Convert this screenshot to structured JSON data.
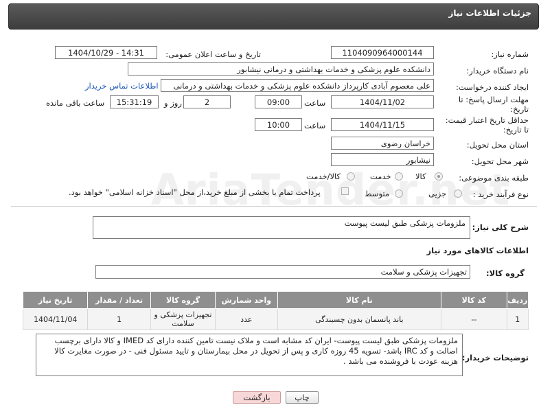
{
  "header": {
    "title": "جزئیات اطلاعات نیاز"
  },
  "fields": {
    "need_number_label": "شماره نیاز:",
    "need_number": "1104090964000144",
    "announce_label": "تاریخ و ساعت اعلان عمومی:",
    "announce_value": "1404/10/29 - 14:31",
    "buyer_org_label": "نام دستگاه خریدار:",
    "buyer_org": "دانشکده علوم پزشکی و خدمات بهداشتی و درمانی نیشابور",
    "creator_label": "ایجاد کننده درخواست:",
    "creator": "علی معصوم آبادی کارپرداز دانشکده علوم پزشکی و خدمات بهداشتی و درمانی",
    "contact_link": "اطلاعات تماس خریدار",
    "deadline_label_1": "مهلت ارسال پاسخ: تا",
    "deadline_label_2": "تاریخ:",
    "deadline_date": "1404/11/02",
    "time_word": "ساعت",
    "deadline_time": "09:00",
    "days_value": "2",
    "days_word": "روز و",
    "remaining_time": "15:31:19",
    "remaining_word": "ساعت باقی مانده",
    "validity_label_1": "حداقل تاریخ اعتبار قیمت:",
    "validity_label_2": "تا تاریخ:",
    "validity_date": "1404/11/15",
    "validity_time": "10:00",
    "province_label": "استان محل تحویل:",
    "province": "خراسان رضوی",
    "city_label": "شهر محل تحویل:",
    "city": "نیشابور",
    "category_label": "طبقه بندی موضوعی:",
    "category_options": [
      "کالا",
      "خدمت",
      "کالا/خدمت"
    ],
    "category_selected": "کالا",
    "process_label": "نوع فرآیند خرید :",
    "process_options": [
      "جزیی",
      "متوسط"
    ],
    "payment_note": "پرداخت تمام یا بخشی از مبلغ خرید،از محل \"اسناد خزانه اسلامی\" خواهد بود."
  },
  "description": {
    "label": "شرح کلی نیاز:",
    "value": "ملزومات پزشکی طبق لیست پیوست"
  },
  "goods_section": {
    "title": "اطلاعات کالاهای مورد نیاز",
    "group_label": "گروه کالا:",
    "group_value": "تجهیزات پزشکی و سلامت"
  },
  "table": {
    "headers": [
      "ردیف",
      "کد کالا",
      "نام کالا",
      "واحد شمارش",
      "گروه کالا",
      "تعداد / مقدار",
      "تاریخ نیاز"
    ],
    "rows": [
      {
        "row": "1",
        "code": "--",
        "name": "باند پانسمان بدون چسبندگی",
        "unit": "عدد",
        "group": "تجهیزات پزشکی و سلامت",
        "qty": "1",
        "date": "1404/11/04"
      }
    ]
  },
  "buyer_notes": {
    "label": "توضیحات خریدار:",
    "value": "ملزومات پزشکی طبق لیست پیوست- ایران کد مشابه است و ملاک نیست  تامین کننده دارای کد IMED  و کالا دارای برچسب اصالت و کد IRC باشد- تسویه 45 روزه کاری و پس از تحویل در محل بیمارستان و تایید مسئول فنی - در صورت مغایرت کالا هزینه عودت با فروشنده می باشد ."
  },
  "buttons": {
    "print": "چاپ",
    "back": "بازگشت"
  },
  "colors": {
    "header_bg": "#4a4a4a",
    "table_header": "#8f8f8f",
    "link": "#1a56b5",
    "back_button": "#f7d7d7"
  }
}
